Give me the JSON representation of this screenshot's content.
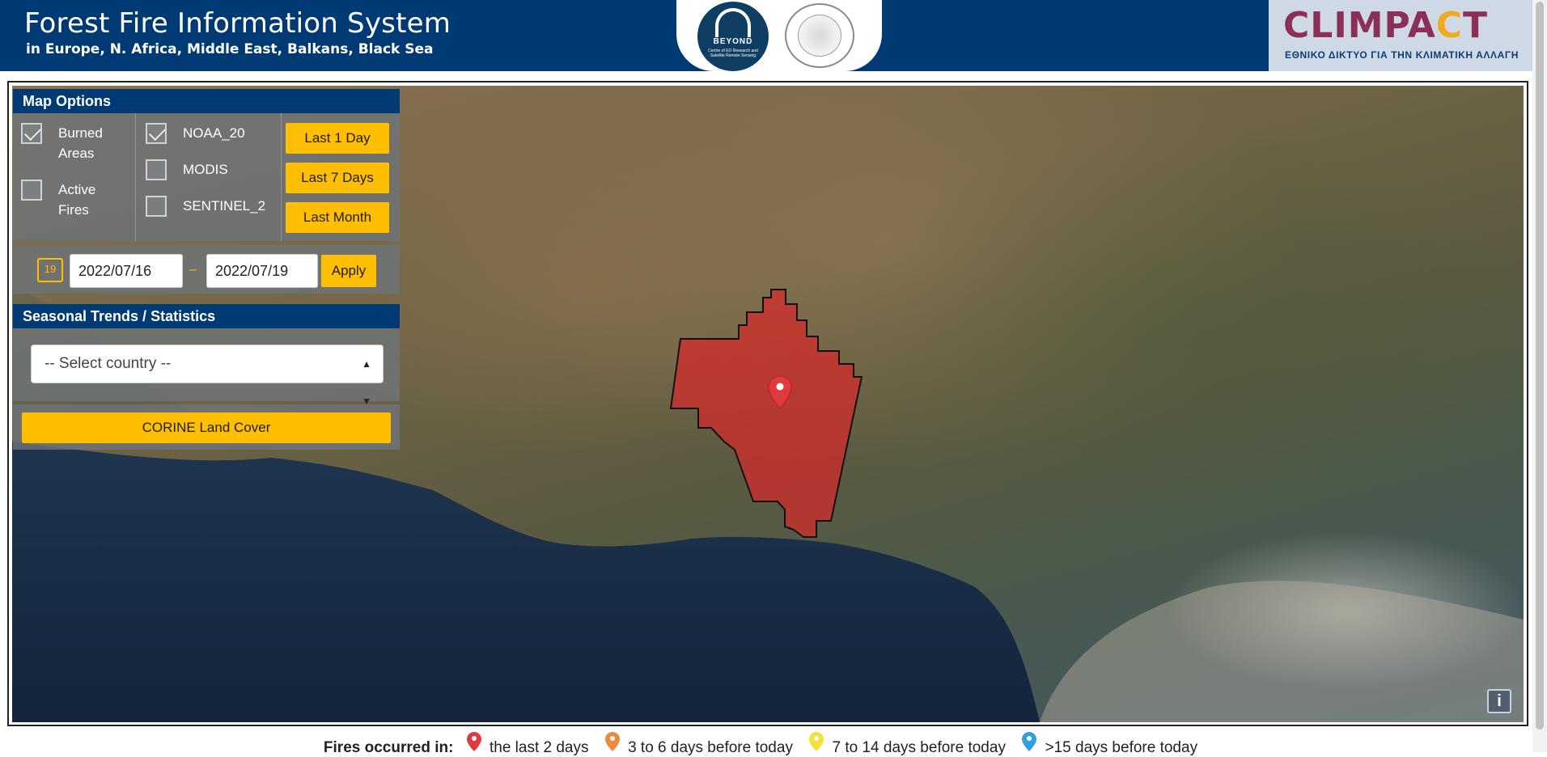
{
  "header": {
    "title": "Forest Fire Information System",
    "subtitle": "in Europe, N. Africa, Middle East, Balkans, Black Sea",
    "beyond_logo_text": "BEYOND",
    "beyond_logo_subtext": "Centre of EO Research and Satellite Remote Sensing",
    "noa_seal_text": "NATIONAL OBSERVATORY OF ATHENS",
    "climpact_word_a": "CLIMPA",
    "climpact_word_b": "C",
    "climpact_word_c": "T",
    "climpact_tagline": "ΕΘΝΙΚΟ ΔΙΚΤΥΟ ΓΙΑ ΤΗΝ ΚΛΙΜΑΤΙΚΗ ΑΛΛΑΓΗ"
  },
  "map_options": {
    "title": "Map Options",
    "layers": [
      {
        "label_1": "Burned",
        "label_2": "Areas",
        "checked": true
      },
      {
        "label_1": "Active",
        "label_2": "Fires",
        "checked": false
      }
    ],
    "sensors": [
      {
        "label": "NOAA_20",
        "checked": true
      },
      {
        "label": "MODIS",
        "checked": false
      },
      {
        "label": "SENTINEL_2",
        "checked": false
      }
    ],
    "quick_ranges": [
      "Last 1 Day",
      "Last 7 Days",
      "Last Month"
    ]
  },
  "date_range": {
    "calendar_icon_text": "19",
    "start": "2022/07/16",
    "separator": "–",
    "end": "2022/07/19",
    "apply_label": "Apply"
  },
  "seasonal_trends": {
    "title": "Seasonal Trends / Statistics",
    "select_value": "-- Select country --"
  },
  "corine_button_label": "CORINE Land Cover",
  "info_button_label": "i",
  "legend": {
    "title": "Fires occurred in:",
    "items": [
      {
        "label": "the last 2 days",
        "color": "#e0393e"
      },
      {
        "label": "3 to 6 days before today",
        "color": "#f0883a"
      },
      {
        "label": "7 to 14 days before today",
        "color": "#f2e23a"
      },
      {
        "label": ">15 days before today",
        "color": "#2ea0de"
      }
    ]
  },
  "colors": {
    "header_bg": "#003a75",
    "accent_yellow": "#ffbf00",
    "burned_area_fill": "#d62a2a",
    "pin_red": "#e0393e"
  },
  "icons": [
    "calendar-icon",
    "map-pin-icon",
    "info-icon",
    "select-arrows-icon",
    "checkmark-icon"
  ]
}
